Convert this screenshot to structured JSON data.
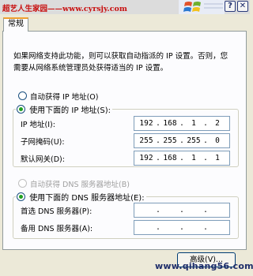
{
  "watermark": {
    "top_left": "超艺人生家园——www.cyrsjy.com",
    "bottom_right": "www.qihang56.com"
  },
  "window": {
    "help_label": "?",
    "close_label": "✕"
  },
  "tab": {
    "label": "常规"
  },
  "description": "如果网络支持此功能，则可以获取自动指派的 IP 设置。否则，您需要从网络系统管理员处获得适当的 IP 设置。",
  "ip_mode": {
    "auto_label": "自动获得 IP 地址(O)",
    "manual_label": "使用下面的 IP 地址(S):",
    "selected": "manual"
  },
  "ip_fields": [
    {
      "label": "IP 地址(I):",
      "octets": [
        "192",
        "168",
        "1",
        "2"
      ]
    },
    {
      "label": "子网掩码(U):",
      "octets": [
        "255",
        "255",
        "255",
        "0"
      ]
    },
    {
      "label": "默认网关(D):",
      "octets": [
        "192",
        "168",
        "1",
        "1"
      ]
    }
  ],
  "dns_mode": {
    "auto_label": "自动获得 DNS 服务器地址(B)",
    "manual_label": "使用下面的 DNS 服务器地址(E):",
    "selected": "manual"
  },
  "dns_fields": [
    {
      "label": "首选 DNS 服务器(P):",
      "octets": [
        "",
        "",
        "",
        ""
      ]
    },
    {
      "label": "备用 DNS 服务器(A):",
      "octets": [
        "",
        "",
        "",
        ""
      ]
    }
  ],
  "advanced_button": "高级(V)...",
  "colors": {
    "radio_dot": "#21a121",
    "tab_highlight": "#f0a030",
    "field_border": "#7f9db9",
    "watermark_red": "#c81010"
  }
}
